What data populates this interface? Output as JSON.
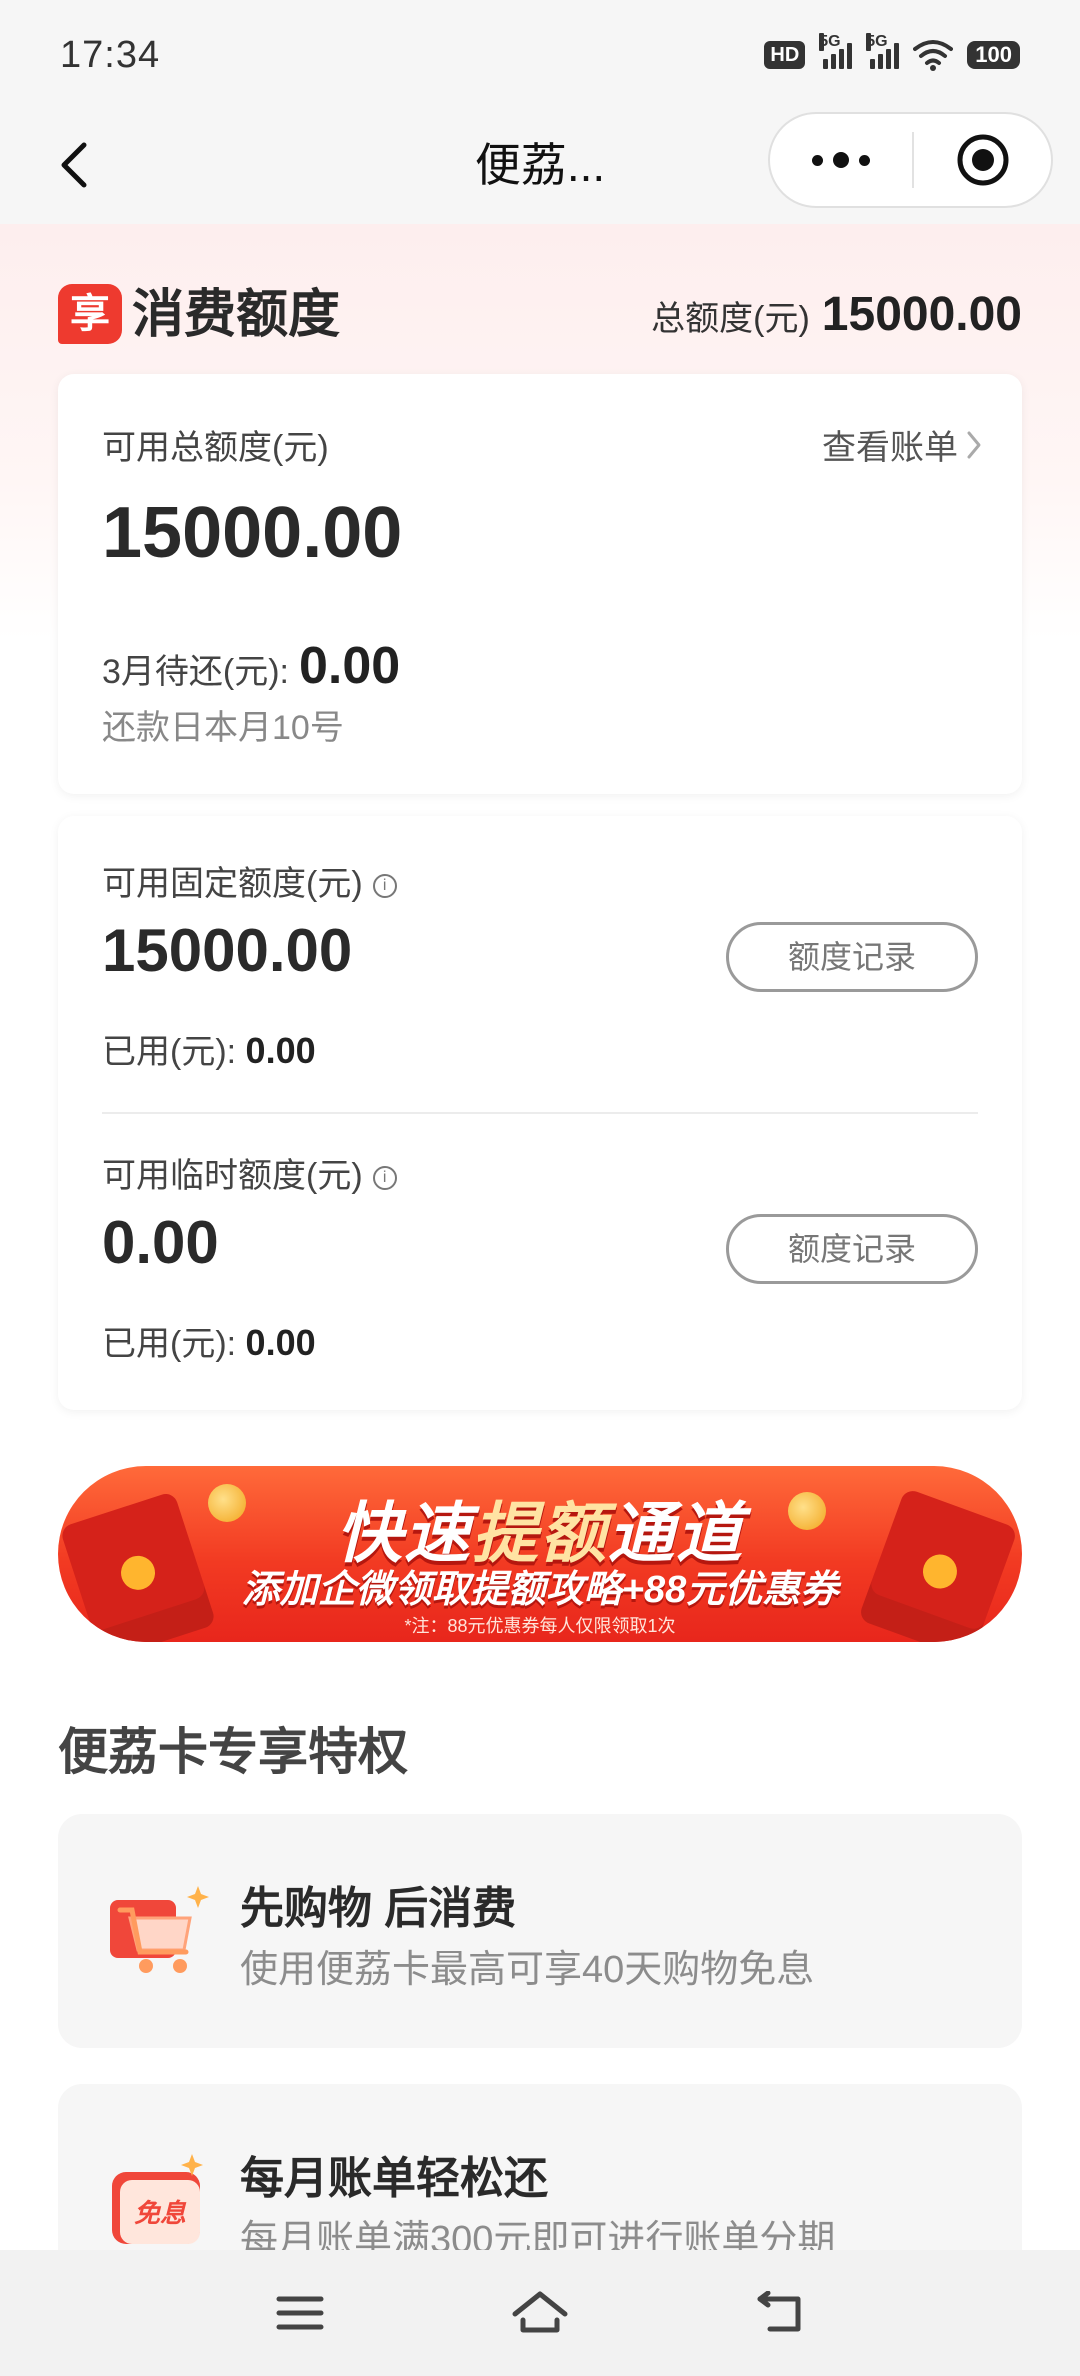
{
  "status_bar": {
    "time": "17:34",
    "hd_badge": "HD",
    "signal1_label": "5G",
    "signal2_label": "5G",
    "battery": "100"
  },
  "nav": {
    "title": "便荔...",
    "back_icon": "chevron-left-icon",
    "more_icon": "more-dots-icon",
    "close_icon": "target-icon"
  },
  "header": {
    "logo_char": "享",
    "title": "消费额度",
    "total_label": "总额度(元)",
    "total_value": "15000.00"
  },
  "card_total": {
    "label": "可用总额度(元)",
    "value": "15000.00",
    "bill_link": "查看账单",
    "due_label": "3月待还(元):",
    "due_value": "0.00",
    "repay_note": "还款日本月10号"
  },
  "card_fixed": {
    "label": "可用固定额度(元)",
    "value": "15000.00",
    "record_button": "额度记录",
    "used_label": "已用(元):",
    "used_value": "0.00"
  },
  "card_temp": {
    "label": "可用临时额度(元)",
    "value": "0.00",
    "record_button": "额度记录",
    "used_label": "已用(元):",
    "used_value": "0.00"
  },
  "banner": {
    "title_a": "快速",
    "title_b": "提额",
    "title_c": "通道",
    "subtitle": "添加企微领取提额攻略+88元优惠券",
    "note": "*注：88元优惠券每人仅限领取1次"
  },
  "privileges": {
    "title": "便荔卡专享特权",
    "items": [
      {
        "heading": "先购物 后消费",
        "desc": "使用便荔卡最高可享40天购物免息",
        "icon": "shopping-cart-icon"
      },
      {
        "heading": "每月账单轻松还",
        "desc": "每月账单满300元即可进行账单分期",
        "icon": "interest-free-icon",
        "icon_text": "免息"
      }
    ]
  },
  "bottom_nav": {
    "menu_icon": "menu-icon",
    "home_icon": "home-icon",
    "back_icon": "back-icon"
  },
  "colors": {
    "brand_red": "#ee3a2f",
    "text_dark": "#2a2a2a",
    "muted": "#8c8c8c"
  }
}
